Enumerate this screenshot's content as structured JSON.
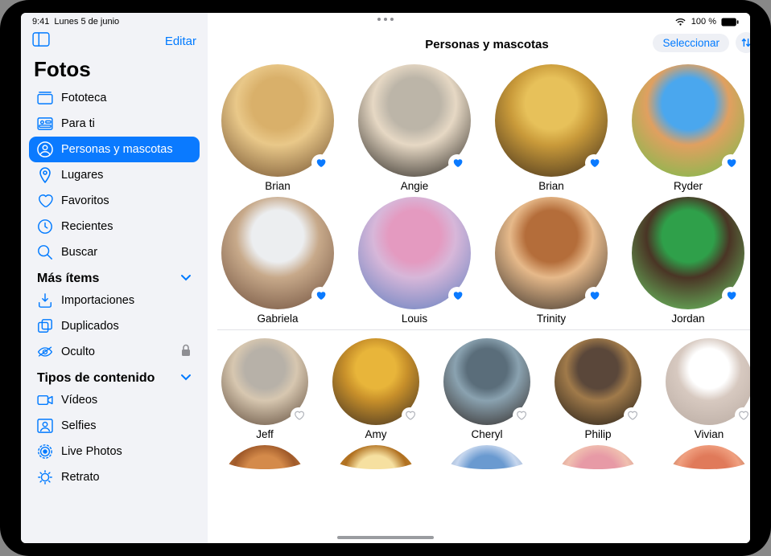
{
  "statusbar": {
    "time": "9:41",
    "date": "Lunes 5 de junio",
    "battery": "100 %"
  },
  "sidebar": {
    "edit_label": "Editar",
    "app_title": "Fotos",
    "items": [
      {
        "label": "Fototeca",
        "icon": "library"
      },
      {
        "label": "Para ti",
        "icon": "for-you"
      },
      {
        "label": "Personas y mascotas",
        "icon": "person-circle",
        "active": true
      },
      {
        "label": "Lugares",
        "icon": "pin"
      },
      {
        "label": "Favoritos",
        "icon": "heart"
      },
      {
        "label": "Recientes",
        "icon": "clock"
      },
      {
        "label": "Buscar",
        "icon": "search"
      }
    ],
    "sections": [
      {
        "title": "Más ítems",
        "items": [
          {
            "label": "Importaciones",
            "icon": "import"
          },
          {
            "label": "Duplicados",
            "icon": "duplicates"
          },
          {
            "label": "Oculto",
            "icon": "hidden",
            "locked": true
          }
        ]
      },
      {
        "title": "Tipos de contenido",
        "items": [
          {
            "label": "Vídeos",
            "icon": "video"
          },
          {
            "label": "Selfies",
            "icon": "selfie"
          },
          {
            "label": "Live Photos",
            "icon": "live"
          },
          {
            "label": "Retrato",
            "icon": "portrait"
          }
        ]
      }
    ]
  },
  "main": {
    "title": "Personas y mascotas",
    "select_label": "Seleccionar",
    "people_large": [
      {
        "name": "Brian",
        "fav": true,
        "colors": [
          "#d9b06a",
          "#6b4a2a",
          "#e9c889"
        ]
      },
      {
        "name": "Angie",
        "fav": true,
        "colors": [
          "#bcb5a8",
          "#1f1c18",
          "#e6d8c4"
        ]
      },
      {
        "name": "Brian",
        "fav": true,
        "colors": [
          "#e7c15a",
          "#3a2a1a",
          "#c99a3a"
        ]
      },
      {
        "name": "Ryder",
        "fav": true,
        "colors": [
          "#4aa7ee",
          "#6fbf4a",
          "#e0a060"
        ]
      },
      {
        "name": "Gabriela",
        "fav": true,
        "colors": [
          "#eceef0",
          "#6a4a38",
          "#c7a98a"
        ]
      },
      {
        "name": "Louis",
        "fav": true,
        "colors": [
          "#e49ac0",
          "#5a7bbd",
          "#d7b7d9"
        ]
      },
      {
        "name": "Trinity",
        "fav": true,
        "colors": [
          "#b46d3a",
          "#2f2a26",
          "#e6b98a"
        ]
      },
      {
        "name": "Jordan",
        "fav": true,
        "colors": [
          "#2fa04a",
          "#6fd36a",
          "#4a3525"
        ]
      }
    ],
    "people_small": [
      {
        "name": "Jeff",
        "fav": false,
        "colors": [
          "#b7b1a8",
          "#5a4636",
          "#d7c7b0"
        ]
      },
      {
        "name": "Amy",
        "fav": false,
        "colors": [
          "#e8b53a",
          "#3a2d22",
          "#c78f2a"
        ]
      },
      {
        "name": "Cheryl",
        "fav": false,
        "colors": [
          "#5a6d7a",
          "#2d2420",
          "#8aa2b0"
        ]
      },
      {
        "name": "Philip",
        "fav": false,
        "colors": [
          "#5a473a",
          "#1f1a16",
          "#a07a4a"
        ]
      },
      {
        "name": "Vivian",
        "fav": false,
        "colors": [
          "#ffffff",
          "#b7a9a0",
          "#d7c9c0"
        ]
      }
    ],
    "people_partial": [
      {
        "colors": [
          "#d48a4a",
          "#f0b060",
          "#a05a2a"
        ]
      },
      {
        "colors": [
          "#f6e0a0",
          "#d9a040",
          "#b07020"
        ]
      },
      {
        "colors": [
          "#6a9ad0",
          "#3a5a8a",
          "#c7d7ee"
        ]
      },
      {
        "colors": [
          "#e79aa6",
          "#a04a3a",
          "#f0c0b0"
        ]
      },
      {
        "colors": [
          "#e07a5a",
          "#4a3020",
          "#f0a080"
        ]
      }
    ]
  }
}
